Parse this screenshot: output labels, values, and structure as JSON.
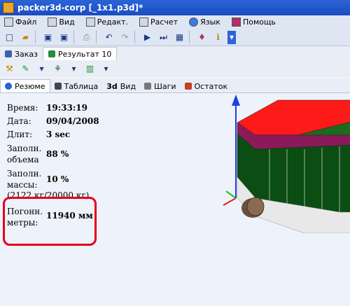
{
  "window": {
    "title": "packer3d-corp [_1x1.p3d]*"
  },
  "menu": [
    "Файл",
    "Вид",
    "Редакт.",
    "Расчет",
    "Язык",
    "Помощь"
  ],
  "doc_tabs": [
    "Заказ",
    "Результат 10"
  ],
  "view_tabs": [
    "Резюме",
    "Таблица",
    "Вид",
    "Шаги",
    "Остаток"
  ],
  "summary": {
    "time_label": "Время:",
    "time": "19:33:19",
    "date_label": "Дата:",
    "date": "09/04/2008",
    "dur_label": "Длит:",
    "dur": "3 sec",
    "vol_label_1": "Заполн.",
    "vol_label_2": "объема",
    "vol": "88 %",
    "mass_label_1": "Заполн.",
    "mass_label_2": "массы:",
    "mass": "10 %",
    "mass_detail": "(2122 кг/20000 кг)",
    "run_label_1": "Погонн.",
    "run_label_2": "метры:",
    "run": "11940 мм"
  },
  "colors": {
    "accent": "#e2001a",
    "cargo_red": "#ff1a1a",
    "cargo_green": "#0b4d12",
    "cargo_purple": "#8b1a5a"
  }
}
